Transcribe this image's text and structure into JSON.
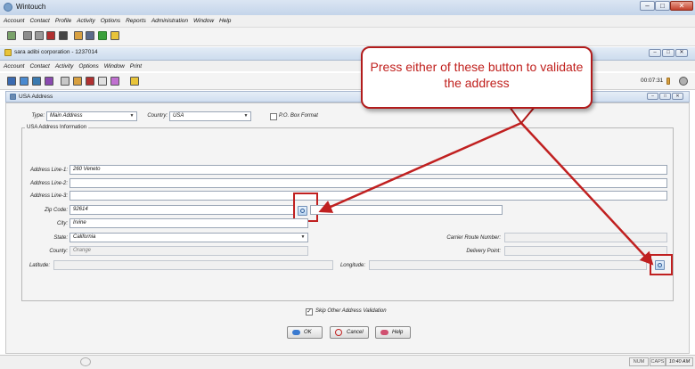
{
  "window": {
    "title": "Wintouch"
  },
  "menu": [
    "Account",
    "Contact",
    "Profile",
    "Activity",
    "Options",
    "Reports",
    "Administration",
    "Window",
    "Help"
  ],
  "inner_window": {
    "title": "sara adibi corporation - 1237014",
    "menu": [
      "Account",
      "Contact",
      "Activity",
      "Options",
      "Window",
      "Print"
    ],
    "timer": "00:07:31"
  },
  "address_panel": {
    "title": "USA Address"
  },
  "form": {
    "type_label": "Type:",
    "type_value": "Main Address",
    "country_label": "Country:",
    "country_value": "USA",
    "po_box_label": "P.O. Box Format",
    "group_label": "USA Address Information",
    "address1_label": "Address Line-1:",
    "address1_value": "260 Veneto",
    "address2_label": "Address Line-2:",
    "address2_value": "",
    "address3_label": "Address Line-3:",
    "address3_value": "",
    "zip_label": "Zip Code:",
    "zip_value": "92614",
    "city_label": "City:",
    "city_value": "Irvine",
    "state_label": "State:",
    "state_value": "California",
    "county_label": "County:",
    "county_value": "Orange",
    "carrier_route_label": "Carrier Route Number:",
    "delivery_point_label": "Delivery Point:",
    "latitude_label": "Latitude:",
    "longitude_label": "Longitude:",
    "skip_validation_label": "Skip Other Address Validation",
    "skip_validation_checked": true
  },
  "buttons": {
    "ok": "OK",
    "cancel": "Cancel",
    "help": "Help"
  },
  "callout": {
    "text": "Press either of these button to validate the address"
  },
  "status": {
    "num": "NUM",
    "caps": "CAPS",
    "time": "10:40 AM"
  },
  "colors": {
    "callout_red": "#c0201d",
    "arrow_red": "#c02020"
  }
}
